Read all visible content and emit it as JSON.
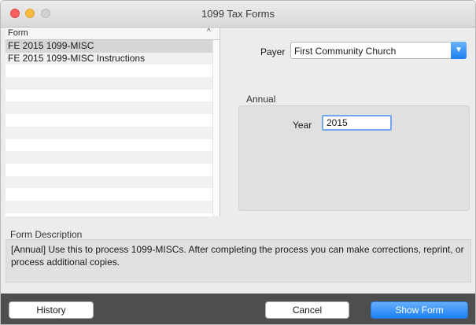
{
  "window": {
    "title": "1099 Tax Forms"
  },
  "form_list": {
    "header": "Form",
    "items": [
      {
        "label": "FE 2015 1099-MISC",
        "selected": true
      },
      {
        "label": "FE 2015 1099-MISC Instructions",
        "selected": false
      }
    ]
  },
  "payer": {
    "label": "Payer",
    "value": "First Community Church"
  },
  "annual": {
    "group_label": "Annual",
    "year_label": "Year",
    "year_value": "2015"
  },
  "description": {
    "label": "Form Description",
    "text": "[Annual] Use this to process 1099-MISCs. After completing the process you can make corrections, reprint, or process additional copies."
  },
  "buttons": {
    "history": "History",
    "cancel": "Cancel",
    "show_form": "Show Form"
  },
  "colors": {
    "accent": "#1d80f7",
    "bottom_bar": "#4e4e4e",
    "panel": "#e0e0e0"
  }
}
